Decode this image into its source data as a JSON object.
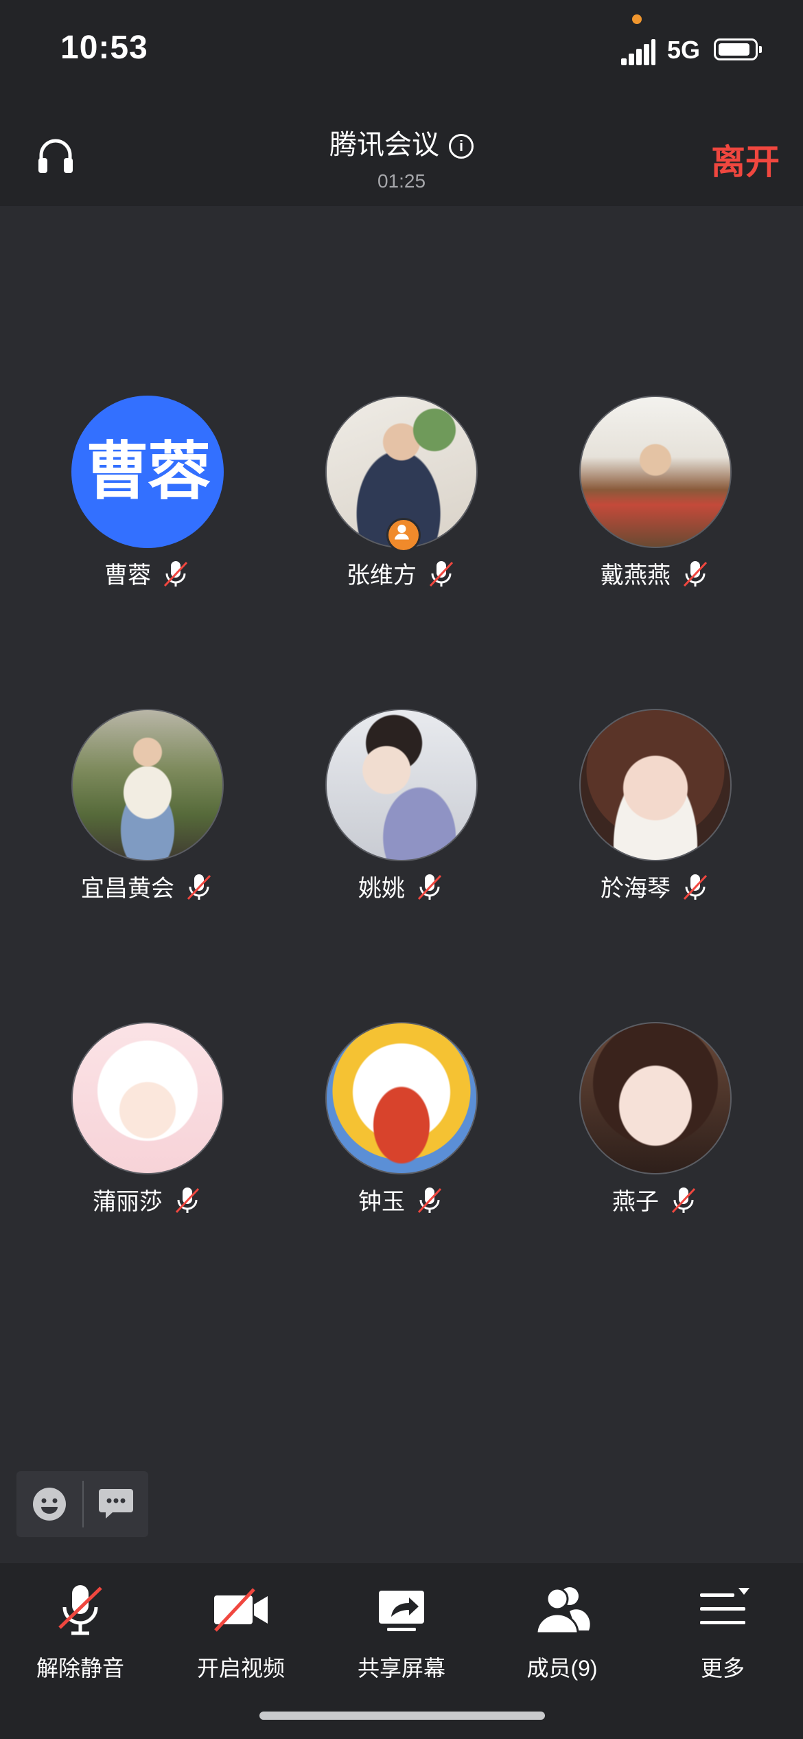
{
  "status_bar": {
    "time": "10:53",
    "network": "5G"
  },
  "header": {
    "title": "腾讯会议",
    "timer": "01:25",
    "leave_label": "离开"
  },
  "participants": [
    {
      "name": "曹蓉",
      "avatar_text": "曹蓉",
      "muted": true
    },
    {
      "name": "张维方",
      "muted": true,
      "host": true
    },
    {
      "name": "戴燕燕",
      "muted": true
    },
    {
      "name": "宜昌黄会",
      "muted": true
    },
    {
      "name": "姚姚",
      "muted": true
    },
    {
      "name": "於海琴",
      "muted": true
    },
    {
      "name": "蒲丽莎",
      "muted": true
    },
    {
      "name": "钟玉",
      "muted": true
    },
    {
      "name": "燕子",
      "muted": true
    }
  ],
  "toolbar": {
    "unmute_label": "解除静音",
    "video_label": "开启视频",
    "share_label": "共享屏幕",
    "members_label": "成员(9)",
    "more_label": "更多"
  },
  "colors": {
    "accent": "#3370ff",
    "leave": "#f0473f",
    "mute_slash": "#f0473f",
    "host_badge": "#f08a2b"
  }
}
